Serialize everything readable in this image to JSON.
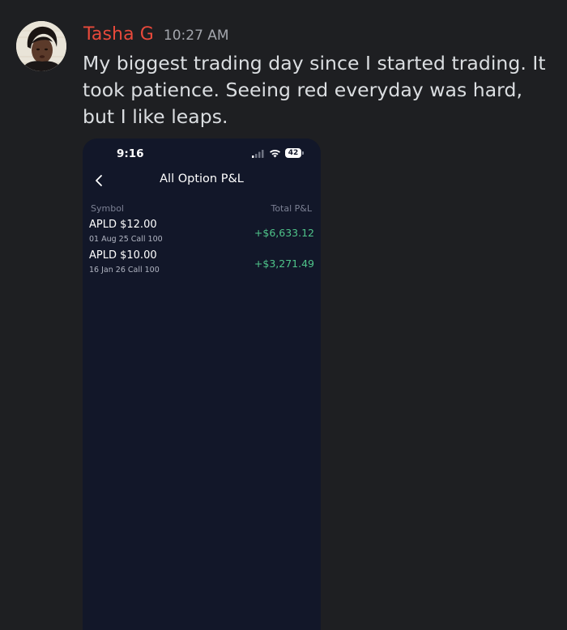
{
  "message": {
    "author": "Tasha G",
    "timestamp": "10:27 AM",
    "text": "My biggest trading day since I started trading. It took patience. Seeing red everyday was hard, but I like leaps.",
    "colors": {
      "author": "#e8493b",
      "text": "#dbdee1",
      "timestamp": "#a3a6ad",
      "background": "#1e1f22"
    }
  },
  "attachment": {
    "status_bar": {
      "time": "9:16",
      "battery": "42",
      "icons": [
        "signal-icon",
        "wifi-icon",
        "battery-icon"
      ]
    },
    "nav": {
      "back_icon": "chevron-left-icon",
      "title": "All Option P&L"
    },
    "table": {
      "headers": {
        "symbol": "Symbol",
        "total_pnl": "Total P&L"
      },
      "rows": [
        {
          "symbol": "APLD $12.00",
          "detail": "01 Aug 25 Call 100",
          "pnl": "+$6,633.12"
        },
        {
          "symbol": "APLD $10.00",
          "detail": "16 Jan 26 Call 100",
          "pnl": "+$3,271.49"
        }
      ]
    },
    "colors": {
      "background": "#121729",
      "positive": "#4fc48a",
      "muted": "#7c8194"
    }
  }
}
